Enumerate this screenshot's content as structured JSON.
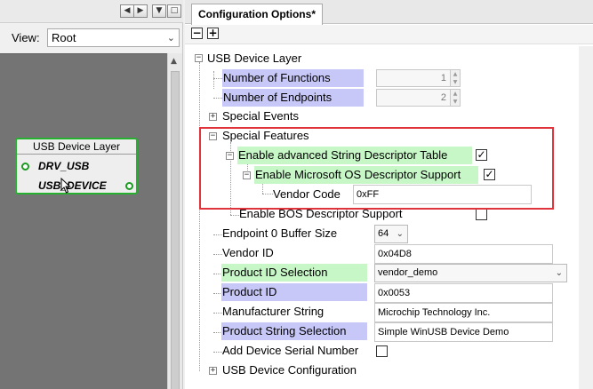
{
  "left_pane": {
    "view_label": "View:",
    "view_value": "Root",
    "component": {
      "title": "USB Device Layer",
      "port_in": "DRV_USB",
      "port_out": "USB_DEVICE"
    }
  },
  "right_pane": {
    "tab_title": "Configuration Options*",
    "toolbar": {
      "collapse_label": "−",
      "expand_label": "+"
    },
    "tree": {
      "root_label": "USB Device Layer",
      "number_of_functions": {
        "label": "Number of Functions",
        "value": "1"
      },
      "number_of_endpoints": {
        "label": "Number of Endpoints",
        "value": "2"
      },
      "special_events": {
        "label": "Special Events"
      },
      "special_features": {
        "label": "Special Features"
      },
      "advanced_string_descriptor": {
        "label": "Enable advanced String Descriptor Table",
        "checked": "✓"
      },
      "ms_os_descriptor": {
        "label": "Enable Microsoft OS Descriptor Support",
        "checked": "✓"
      },
      "vendor_code": {
        "label": "Vendor Code",
        "value": "0xFF"
      },
      "bos_descriptor": {
        "label": "Enable BOS Descriptor Support",
        "checked": ""
      },
      "endpoint0_buffer_size": {
        "label": "Endpoint 0 Buffer Size",
        "value": "64"
      },
      "vendor_id": {
        "label": "Vendor ID",
        "value": "0x04D8"
      },
      "product_id_selection": {
        "label": "Product ID Selection",
        "value": "vendor_demo"
      },
      "product_id": {
        "label": "Product ID",
        "value": "0x0053"
      },
      "manufacturer_string": {
        "label": "Manufacturer String",
        "value": "Microchip Technology Inc."
      },
      "product_string_selection": {
        "label": "Product String Selection",
        "value": "Simple WinUSB Device Demo"
      },
      "add_device_serial_number": {
        "label": "Add Device Serial Number",
        "checked": ""
      },
      "usb_device_configuration": {
        "label": "USB Device Configuration"
      }
    }
  },
  "colors": {
    "highlight_red": "#e0343c",
    "component_green": "#27b02f",
    "label_blue": "#c8c8f8",
    "label_green": "#c7f7c7",
    "canvas_gray": "#747474"
  }
}
